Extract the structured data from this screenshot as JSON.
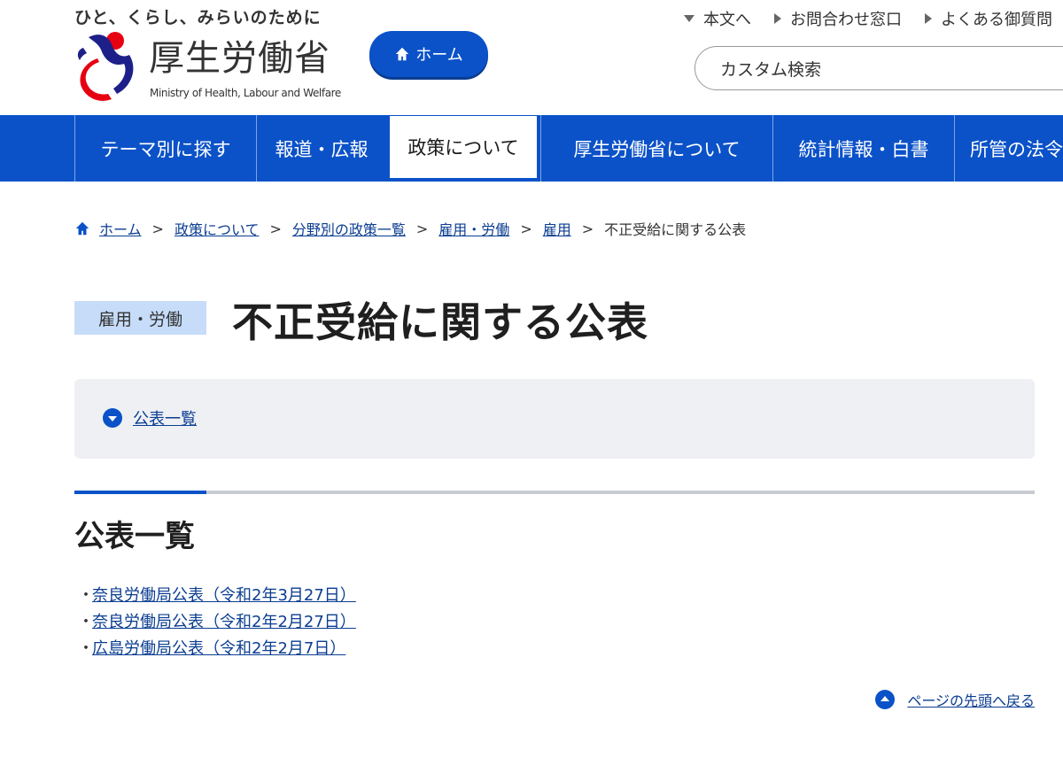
{
  "header": {
    "tagline": "ひと、くらし、みらいのために",
    "logo_jp": "厚生労働省",
    "logo_en": "Ministry of Health, Labour and Welfare",
    "home_button": "ホーム",
    "util_links": [
      "本文へ",
      "お問合わせ窓口",
      "よくある御質問"
    ],
    "search_placeholder": "カスタム検索"
  },
  "gnav": {
    "items": [
      "テーマ別に探す",
      "報道・広報",
      "政策について",
      "厚生労働省について",
      "統計情報・白書",
      "所管の法令"
    ],
    "active": "政策について"
  },
  "breadcrumb": {
    "items": [
      "ホーム",
      "政策について",
      "分野別の政策一覧",
      "雇用・労働",
      "雇用"
    ],
    "current": "不正受給に関する公表",
    "separator": ">"
  },
  "page": {
    "category": "雇用・労働",
    "title": "不正受給に関する公表",
    "anchor_link": "公表一覧"
  },
  "section": {
    "title": "公表一覧",
    "bullet": "・",
    "items": [
      "奈良労働局公表（令和2年3月27日）",
      "奈良労働局公表（令和2年2月27日）",
      "広島労働局公表（令和2年2月7日）"
    ]
  },
  "pagetop_label": "ページの先頭へ戻る",
  "colors": {
    "primary": "#0b52c8",
    "badge": "#c6dcf9",
    "anchor_bg": "#eef0f4",
    "logo_red": "#e60012",
    "logo_navy": "#1d2088"
  }
}
